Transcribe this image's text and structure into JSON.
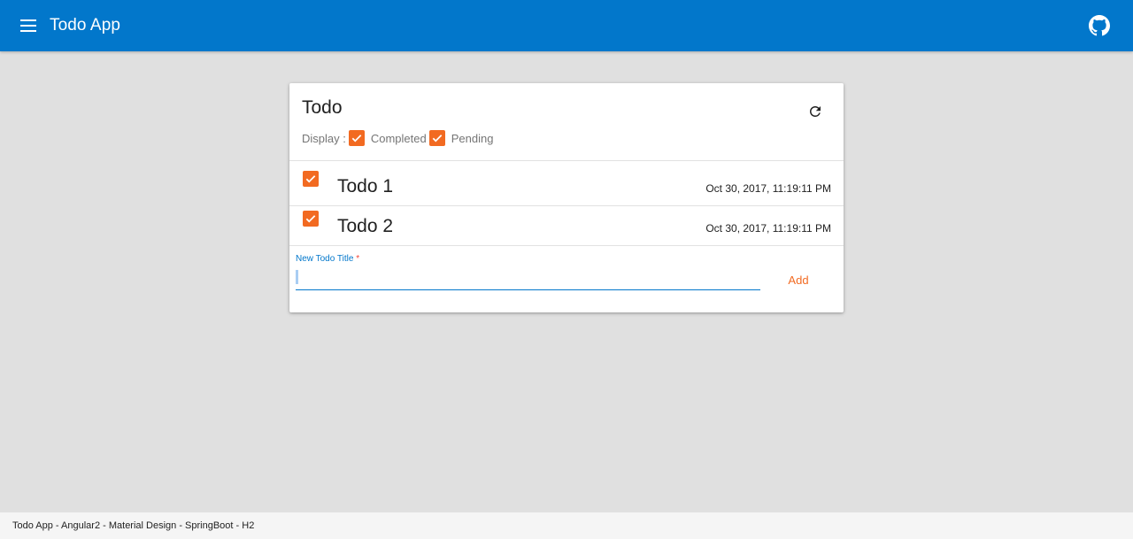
{
  "app": {
    "title": "Todo App",
    "menu_icon": "menu-icon",
    "github_icon": "github-icon",
    "primary_color": "#0277cb",
    "accent_color": "#f26a21"
  },
  "card": {
    "title": "Todo",
    "refresh_icon": "refresh-icon",
    "display_label": "Display :",
    "filters": [
      {
        "label": "Completed",
        "checked": true
      },
      {
        "label": "Pending",
        "checked": true
      }
    ]
  },
  "todos": [
    {
      "title": "Todo 1",
      "date": "Oct 30, 2017, 11:19:11 PM",
      "completed": true
    },
    {
      "title": "Todo 2",
      "date": "Oct 30, 2017, 11:19:11 PM",
      "completed": true
    }
  ],
  "new_todo": {
    "label": "New Todo Title",
    "required_mark": "*",
    "value": "",
    "add_label": "Add"
  },
  "footer": {
    "text": "Todo App - Angular2 - Material Design - SpringBoot - H2"
  }
}
